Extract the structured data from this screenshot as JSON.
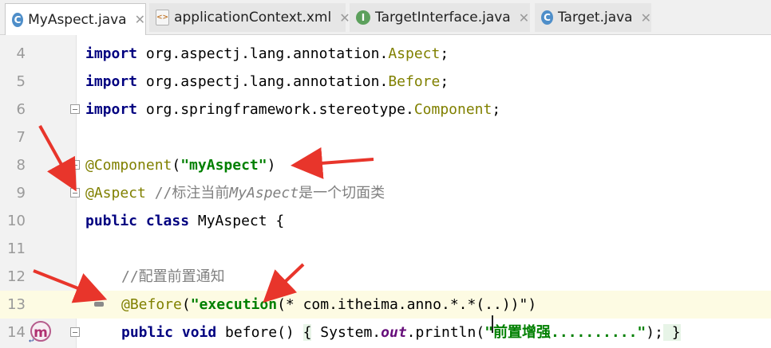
{
  "tabs": [
    {
      "label": "MyAspect.java",
      "icon": "C",
      "icon_name": "class-icon",
      "active": true
    },
    {
      "label": "applicationContext.xml",
      "icon": "<>",
      "icon_name": "xml-file-icon",
      "active": false
    },
    {
      "label": "TargetInterface.java",
      "icon": "I",
      "icon_name": "interface-icon",
      "active": false
    },
    {
      "label": "Target.java",
      "icon": "C",
      "icon_name": "class-icon",
      "active": false
    }
  ],
  "close_glyph": "✕",
  "colors": {
    "keyword": "#000080",
    "annotation": "#808000",
    "string": "#008000",
    "comment": "#808080",
    "arrow": "#e8352b",
    "line_highlight": "#fdfbe3"
  },
  "lines": [
    {
      "num": "4",
      "parts": [
        "import",
        " org.aspectj.lang.annotation.",
        "Aspect",
        ";"
      ]
    },
    {
      "num": "5",
      "parts": [
        "import",
        " org.aspectj.lang.annotation.",
        "Before",
        ";"
      ]
    },
    {
      "num": "6",
      "parts": [
        "import",
        " org.springframework.stereotype.",
        "Component",
        ";"
      ]
    },
    {
      "num": "7",
      "parts": []
    },
    {
      "num": "8",
      "parts": [
        "@Component",
        "(",
        "\"myAspect\"",
        ")"
      ]
    },
    {
      "num": "9",
      "parts": [
        "@Aspect",
        " //标注当前",
        "MyAspect",
        "是一个切面类"
      ]
    },
    {
      "num": "10",
      "parts": [
        "public class",
        " MyAspect {"
      ]
    },
    {
      "num": "11",
      "parts": []
    },
    {
      "num": "12",
      "parts": [
        "//配置前置通知"
      ]
    },
    {
      "num": "13",
      "parts": [
        "@Before",
        "(",
        "\"execution",
        "(* com.itheima.anno.*.*(..))\"",
        ")"
      ]
    },
    {
      "num": "14",
      "parts": [
        "public void",
        " before() ",
        "{",
        " System.",
        "out",
        ".println(",
        "\"前置增强..........\"",
        ");",
        " }"
      ]
    }
  ]
}
